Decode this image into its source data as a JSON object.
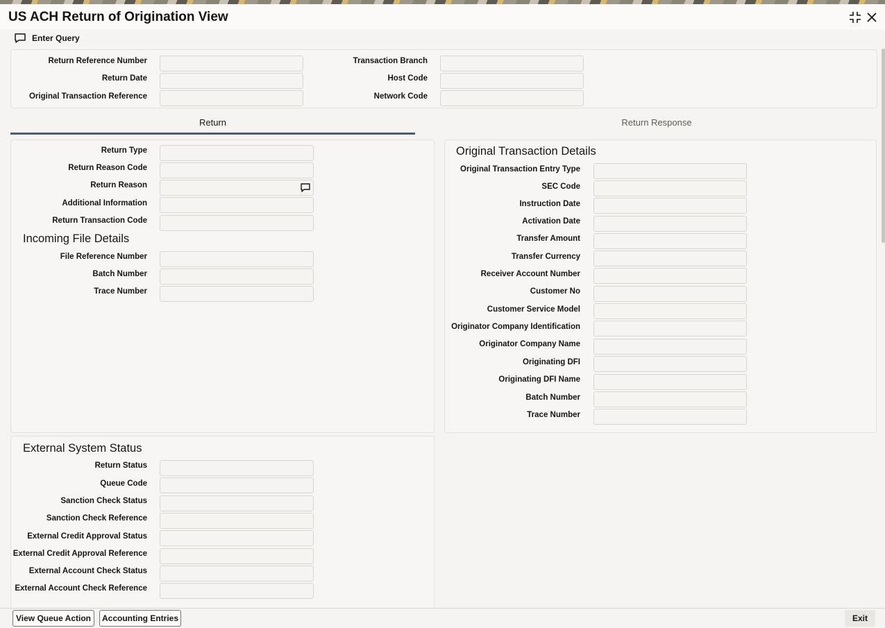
{
  "window": {
    "title": "US ACH Return of Origination View"
  },
  "toolbar": {
    "enter_query": "Enter Query"
  },
  "header": {
    "return_reference_number": "Return Reference Number",
    "return_date": "Return Date",
    "original_transaction_reference": "Original Transaction Reference",
    "transaction_branch": "Transaction Branch",
    "host_code": "Host Code",
    "network_code": "Network Code"
  },
  "tabs": {
    "return": "Return",
    "return_response": "Return Response"
  },
  "return_section": {
    "return_type": "Return Type",
    "return_reason_code": "Return Reason Code",
    "return_reason": "Return Reason",
    "additional_information": "Additional Information",
    "return_transaction_code": "Return Transaction Code"
  },
  "incoming_file": {
    "heading": "Incoming File Details",
    "file_reference_number": "File Reference Number",
    "batch_number": "Batch Number",
    "trace_number": "Trace Number"
  },
  "original_txn": {
    "heading": "Original Transaction Details",
    "entry_type": "Original Transaction Entry Type",
    "sec_code": "SEC Code",
    "instruction_date": "Instruction Date",
    "activation_date": "Activation Date",
    "transfer_amount": "Transfer Amount",
    "transfer_currency": "Transfer Currency",
    "receiver_account_number": "Receiver Account Number",
    "customer_no": "Customer No",
    "customer_service_model": "Customer Service Model",
    "originator_company_identification": "Originator Company Identification",
    "originator_company_name": "Originator Company Name",
    "originating_dfi": "Originating DFI",
    "originating_dfi_name": "Originating DFI Name",
    "batch_number": "Batch Number",
    "trace_number": "Trace Number"
  },
  "external_status": {
    "heading": "External System Status",
    "return_status": "Return Status",
    "queue_code": "Queue Code",
    "sanction_check_status": "Sanction Check Status",
    "sanction_check_reference": "Sanction Check Reference",
    "external_credit_approval_status": "External Credit Approval Status",
    "external_credit_approval_reference": "External Credit Approval Reference",
    "external_account_check_status": "External Account Check Status",
    "external_account_check_reference": "External Account Check Reference"
  },
  "footer": {
    "view_queue_action": "View Queue Action",
    "accounting_entries": "Accounting Entries",
    "exit": "Exit"
  },
  "icons": {
    "enter_query": "chat-bubble-icon",
    "return_reason_lookup": "chat-bubble-icon",
    "minimize": "collapse-icon",
    "close": "close-icon"
  }
}
